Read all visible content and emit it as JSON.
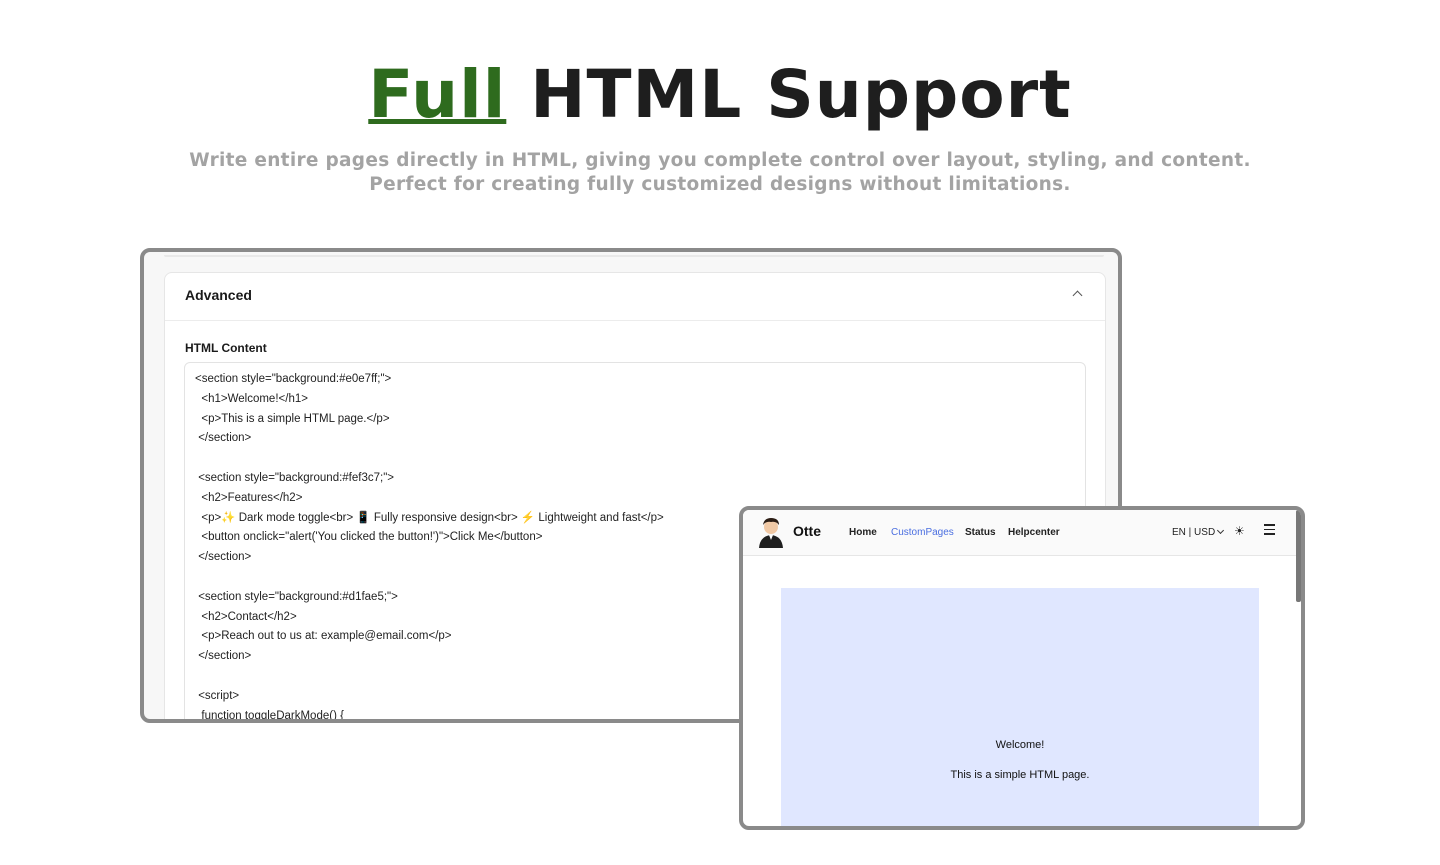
{
  "hero": {
    "title_accent": "Full",
    "title_rest": " HTML Support",
    "subtitle_line1": "Write entire pages directly in HTML, giving you complete control over layout, styling, and content.",
    "subtitle_line2": "Perfect for creating fully customized designs without limitations."
  },
  "editor": {
    "section_title": "Advanced",
    "field_label": "HTML Content",
    "code": "<section style=\"background:#e0e7ff;\">\n  <h1>Welcome!</h1>\n  <p>This is a simple HTML page.</p>\n </section>\n\n <section style=\"background:#fef3c7;\">\n  <h2>Features</h2>\n  <p>✨ Dark mode toggle<br> 📱 Fully responsive design<br> ⚡ Lightweight and fast</p>\n  <button onclick=\"alert('You clicked the button!')\">Click Me</button>\n </section>\n\n <section style=\"background:#d1fae5;\">\n  <h2>Contact</h2>\n  <p>Reach out to us at: example@email.com</p>\n </section>\n\n <script>\n  function toggleDarkMode() {"
  },
  "preview": {
    "brand": "Otte",
    "nav": [
      "Home",
      "CustomPages",
      "Status",
      "Helpcenter"
    ],
    "locale": "EN | USD",
    "heading": "Welcome!",
    "paragraph": "This is a simple HTML page.",
    "section_bg": "#e0e7ff",
    "active_color": "#4a6ee0"
  },
  "colors": {
    "accent": "#2e6b1e",
    "subtitle": "#a3a3a3",
    "frame": "#8a8a8a"
  }
}
